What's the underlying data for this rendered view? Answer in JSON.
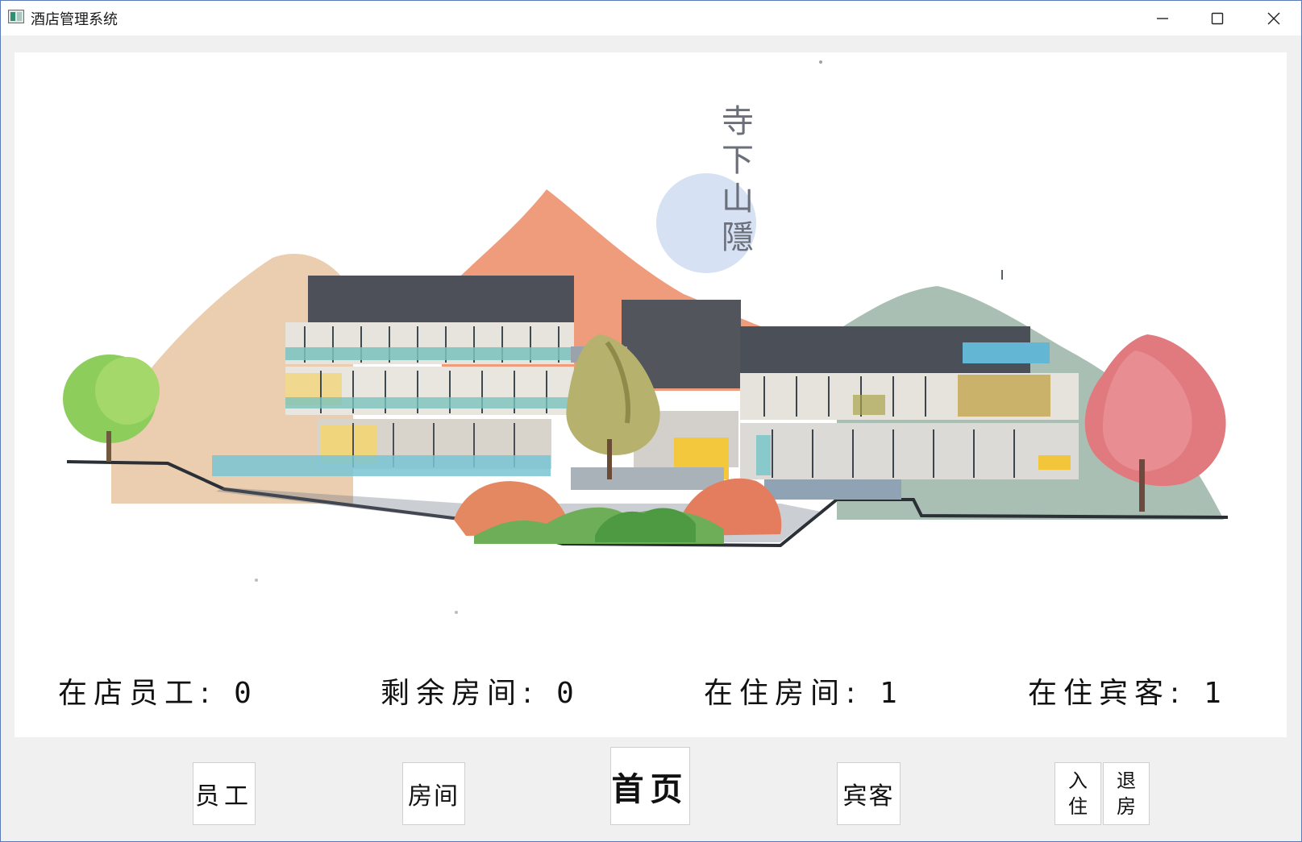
{
  "window": {
    "title": "酒店管理系统"
  },
  "hero": {
    "vertical_title": "寺\n下\n山\n隱"
  },
  "stats": [
    {
      "label": "在店员工:",
      "value": "0"
    },
    {
      "label": "剩余房间:",
      "value": "0"
    },
    {
      "label": "在住房间:",
      "value": "1"
    },
    {
      "label": "在住宾客:",
      "value": "1"
    }
  ],
  "nav": {
    "staff": "员工",
    "rooms": "房间",
    "home": "首页",
    "guests": "宾客",
    "checkin": "入\n住",
    "checkout": "退\n房"
  },
  "icons": {
    "app": "app-window-icon",
    "minimize": "minimize-icon",
    "maximize": "maximize-icon",
    "close": "close-icon"
  }
}
